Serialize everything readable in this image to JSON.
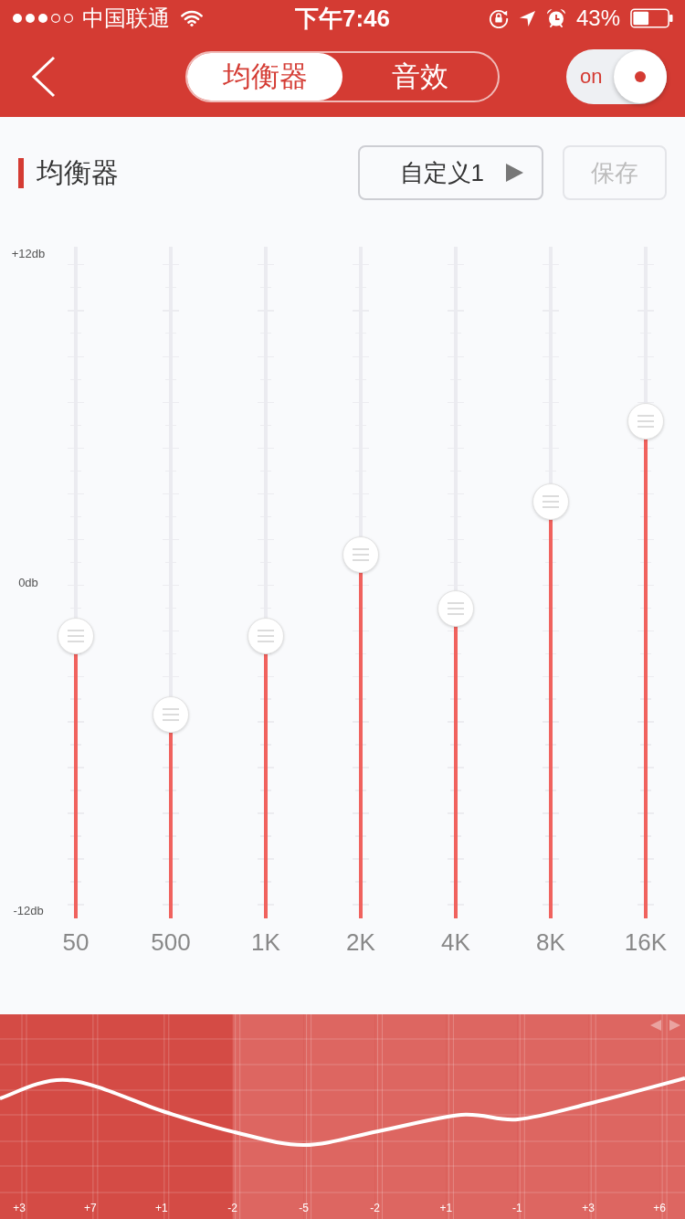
{
  "status_bar": {
    "carrier": "中国联通",
    "time": "下午7:46",
    "battery": "43%"
  },
  "nav": {
    "tabs": [
      {
        "label": "均衡器",
        "selected": true
      },
      {
        "label": "音效",
        "selected": false
      }
    ],
    "switch": {
      "label": "on",
      "on": true
    }
  },
  "section": {
    "title": "均衡器",
    "preset_dropdown": {
      "value": "自定义1"
    },
    "save_button": {
      "label": "保存",
      "disabled": true
    }
  },
  "axis": {
    "labels": [
      "+12db",
      "0db",
      "-12db"
    ]
  },
  "bands": [
    {
      "label": "50",
      "level": 0.421
    },
    {
      "label": "500",
      "level": 0.304
    },
    {
      "label": "1K",
      "level": 0.421
    },
    {
      "label": "2K",
      "level": 0.541
    },
    {
      "label": "4K",
      "level": 0.461
    },
    {
      "label": "8K",
      "level": 0.62
    },
    {
      "label": "16K",
      "level": 0.74
    }
  ],
  "overview": {
    "bands": [
      {
        "label": "+3",
        "visible": false
      },
      {
        "label": "+7",
        "visible": false
      },
      {
        "label": "+1",
        "visible": false
      },
      {
        "label": "-2",
        "visible": true
      },
      {
        "label": "-5",
        "visible": true
      },
      {
        "label": "-2",
        "visible": true
      },
      {
        "label": "+1",
        "visible": true
      },
      {
        "label": "-1",
        "visible": true
      },
      {
        "label": "+3",
        "visible": true
      },
      {
        "label": "+6",
        "visible": true
      }
    ]
  }
}
